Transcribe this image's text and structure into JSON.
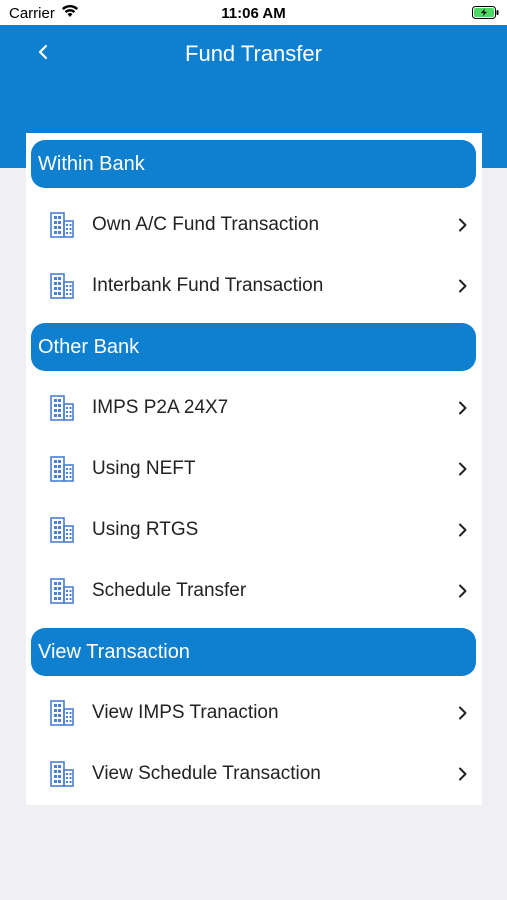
{
  "status_bar": {
    "carrier": "Carrier",
    "time": "11:06 AM"
  },
  "header": {
    "title": "Fund Transfer",
    "back_icon": "chevron-left-icon"
  },
  "colors": {
    "primary": "#0f80cf",
    "icon": "#4a7fd1",
    "background": "#efeff4"
  },
  "sections": [
    {
      "title": "Within Bank",
      "items": [
        {
          "label": "Own A/C Fund Transaction"
        },
        {
          "label": "Interbank Fund Transaction"
        }
      ]
    },
    {
      "title": "Other Bank",
      "items": [
        {
          "label": "IMPS P2A 24X7"
        },
        {
          "label": "Using NEFT"
        },
        {
          "label": "Using RTGS"
        },
        {
          "label": "Schedule Transfer"
        }
      ]
    },
    {
      "title": "View Transaction",
      "items": [
        {
          "label": "View IMPS Tranaction"
        },
        {
          "label": "View Schedule Transaction"
        }
      ]
    }
  ],
  "item_icon": "building-icon",
  "item_chevron": "chevron-right-icon"
}
